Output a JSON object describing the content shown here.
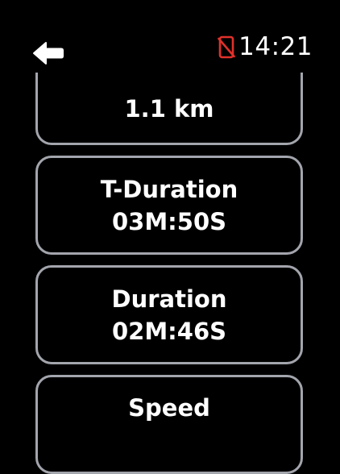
{
  "status": {
    "time": "14:21",
    "disconnect_icon": "phone-disconnected-icon",
    "disconnect_color": "#e0312b"
  },
  "nav": {
    "back_icon": "back-arrow-icon"
  },
  "metrics": {
    "distance": {
      "value": "1.1 km"
    },
    "t_duration": {
      "label": "T-Duration",
      "value": "03M:50S"
    },
    "duration": {
      "label": "Duration",
      "value": "02M:46S"
    },
    "speed": {
      "label": "Speed"
    }
  },
  "colors": {
    "background": "#000000",
    "text": "#ffffff",
    "card_border": "#a3a5ad"
  }
}
